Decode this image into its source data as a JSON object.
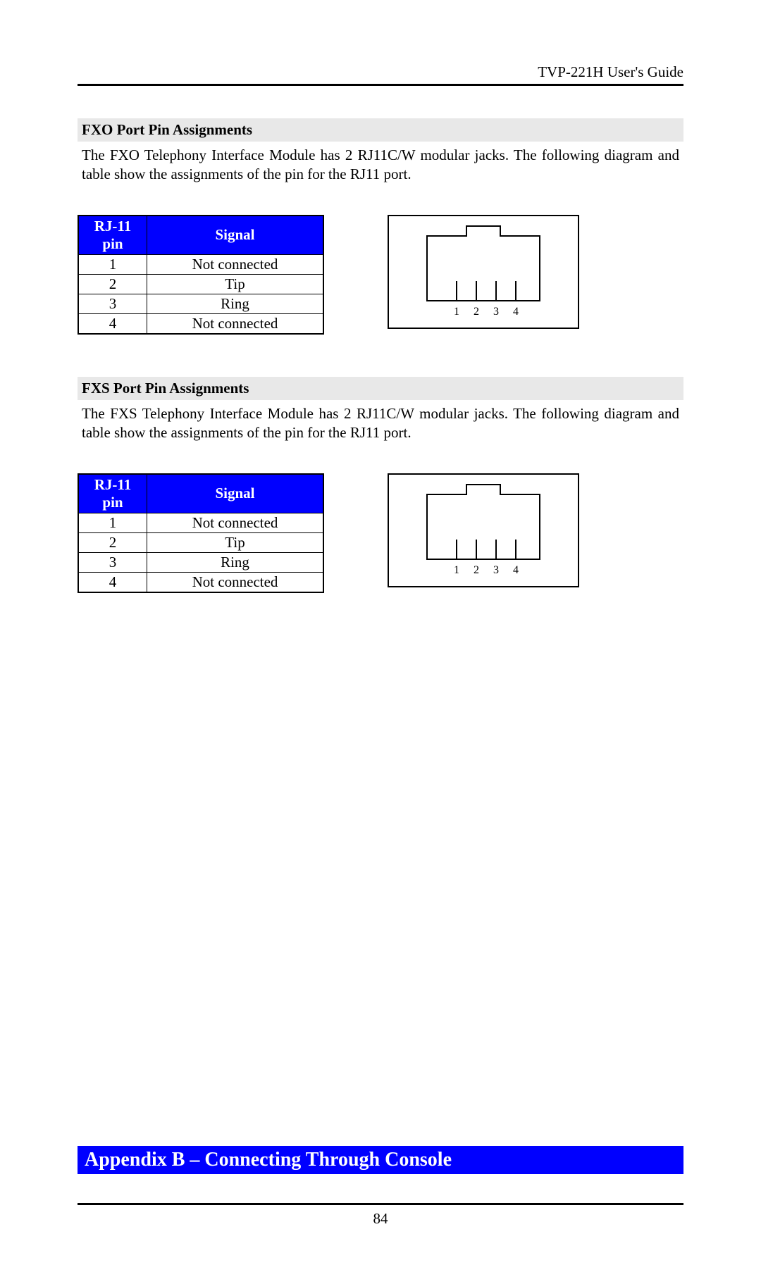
{
  "running_head": "TVP-221H User's Guide",
  "page_number": "84",
  "fxo": {
    "title": "FXO Port Pin Assignments",
    "para": "The FXO Telephony Interface Module has 2 RJ11C/W modular jacks. The following diagram and table show the assignments of the pin for the RJ11 port.",
    "table": {
      "head_pin": "RJ-11 pin",
      "head_signal": "Signal",
      "rows": [
        {
          "pin": "1",
          "signal": "Not connected"
        },
        {
          "pin": "2",
          "signal": "Tip"
        },
        {
          "pin": "3",
          "signal": "Ring"
        },
        {
          "pin": "4",
          "signal": "Not connected"
        }
      ]
    },
    "diagram_labels": [
      "1",
      "2",
      "3",
      "4"
    ]
  },
  "fxs": {
    "title": "FXS Port Pin Assignments",
    "para": "The FXS Telephony Interface Module has 2 RJ11C/W modular jacks. The following diagram and table show the assignments of the pin for the RJ11 port.",
    "table": {
      "head_pin": "RJ-11 pin",
      "head_signal": "Signal",
      "rows": [
        {
          "pin": "1",
          "signal": "Not connected"
        },
        {
          "pin": "2",
          "signal": "Tip"
        },
        {
          "pin": "3",
          "signal": "Ring"
        },
        {
          "pin": "4",
          "signal": "Not connected"
        }
      ]
    },
    "diagram_labels": [
      "1",
      "2",
      "3",
      "4"
    ]
  },
  "appendix_title": "Appendix B – Connecting Through Console"
}
